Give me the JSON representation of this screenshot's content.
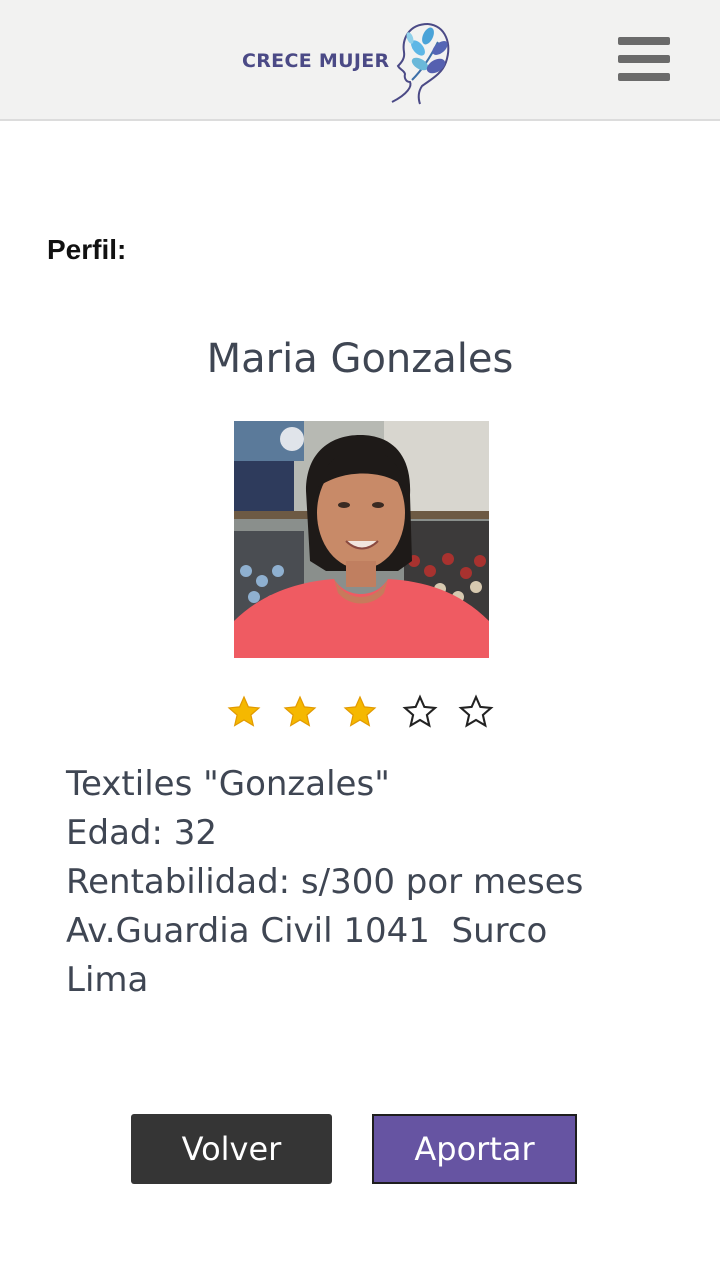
{
  "header": {
    "logo_text": "CRECE MUJER",
    "menu_icon": "hamburger-menu-icon",
    "brand_color": "#4b4a86"
  },
  "profile": {
    "section_label": "Perfil:",
    "name": "Maria Gonzales",
    "photo": "woman-portrait-photo",
    "rating": {
      "value": 3,
      "max": 5,
      "filled_color": "#f5b800"
    },
    "details": {
      "business": "Textiles \"Gonzales\"",
      "age": "Edad: 32",
      "profitability": "Rentabilidad: s/300 por meses",
      "address_line1": "Av.Guardia Civil 1041  Surco",
      "address_line2": "Lima"
    }
  },
  "actions": {
    "back_label": "Volver",
    "contribute_label": "Aportar",
    "contribute_color": "#6654a2"
  }
}
